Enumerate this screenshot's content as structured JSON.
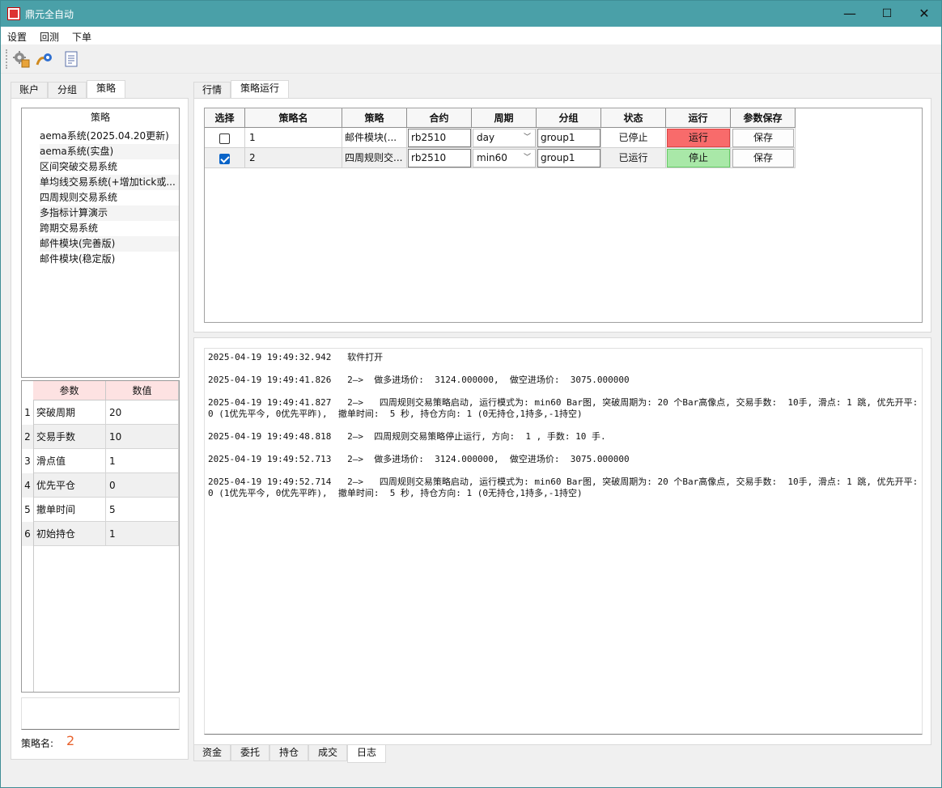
{
  "window": {
    "title": "鼎元全自动",
    "minimize": "—",
    "maximize": "☐",
    "close": "✕"
  },
  "menu": [
    "设置",
    "回测",
    "下单"
  ],
  "toolbar_icons": [
    "settings-gear-icon",
    "backtest-icon",
    "document-icon"
  ],
  "left_tabs": [
    "账户",
    "分组",
    "策略"
  ],
  "left_active_tab": "策略",
  "strategy_list": {
    "header": "策略",
    "items": [
      "aema系统(2025.04.20更新)",
      "aema系统(实盘)",
      "区间突破交易系统",
      "单均线交易系统(+增加tick或...",
      "四周规则交易系统",
      "多指标计算演示",
      "跨期交易系统",
      "邮件模块(完善版)",
      "邮件模块(稳定版)"
    ]
  },
  "params": {
    "headers": [
      "参数",
      "数值"
    ],
    "rows": [
      {
        "num": "1",
        "name": "突破周期",
        "value": "20"
      },
      {
        "num": "2",
        "name": "交易手数",
        "value": "10"
      },
      {
        "num": "3",
        "name": "滑点值",
        "value": "1"
      },
      {
        "num": "4",
        "name": "优先平仓",
        "value": "0"
      },
      {
        "num": "5",
        "name": "撤单时间",
        "value": "5"
      },
      {
        "num": "6",
        "name": "初始持仓",
        "value": "1"
      }
    ]
  },
  "strategy_name": {
    "label": "策略名:",
    "value": "2"
  },
  "right_tabs": [
    "行情",
    "策略运行"
  ],
  "right_active_tab": "策略运行",
  "run_table": {
    "headers": [
      "选择",
      "策略名",
      "策略",
      "合约",
      "周期",
      "分组",
      "状态",
      "运行",
      "参数保存"
    ],
    "rows": [
      {
        "checked": false,
        "name": "1",
        "strategy": "邮件模块(...",
        "contract": "rb2510",
        "period": "day",
        "group": "group1",
        "status": "已停止",
        "run": "运行",
        "save": "保存"
      },
      {
        "checked": true,
        "name": "2",
        "strategy": "四周规则交...",
        "contract": "rb2510",
        "period": "min60",
        "group": "group1",
        "status": "已运行",
        "run": "停止",
        "save": "保存"
      }
    ]
  },
  "log": [
    "2025-04-19 19:49:32.942   软件打开",
    "2025-04-19 19:49:41.826   2—>  做多进场价:  3124.000000,  做空进场价:  3075.000000",
    "2025-04-19 19:49:41.827   2—>   四周规则交易策略启动, 运行模式为: min60 Bar图, 突破周期为: 20 个Bar高像点, 交易手数:  10手, 滑点: 1 跳, 优先开平:  0 (1优先平今, 0优先平昨),  撤单时间:  5 秒, 持仓方向: 1 (0无持仓,1持多,-1持空)",
    "2025-04-19 19:49:48.818   2—>  四周规则交易策略停止运行, 方向:  1 , 手数: 10 手.",
    "2025-04-19 19:49:52.713   2—>  做多进场价:  3124.000000,  做空进场价:  3075.000000",
    "2025-04-19 19:49:52.714   2—>   四周规则交易策略启动, 运行模式为: min60 Bar图, 突破周期为: 20 个Bar高像点, 交易手数:  10手, 滑点: 1 跳, 优先开平:  0 (1优先平今, 0优先平昨),  撤单时间:  5 秒, 持仓方向: 1 (0无持仓,1持多,-1持空)"
  ],
  "bottom_tabs": [
    "资金",
    "委托",
    "持仓",
    "成交",
    "日志"
  ],
  "bottom_active_tab": "日志",
  "colors": {
    "titlebar": "#4aa0a8",
    "run_button": "#f86b6b",
    "stop_button": "#a9e8a8",
    "param_header": "#fde2e2",
    "strategy_name_value": "#e8612c"
  }
}
